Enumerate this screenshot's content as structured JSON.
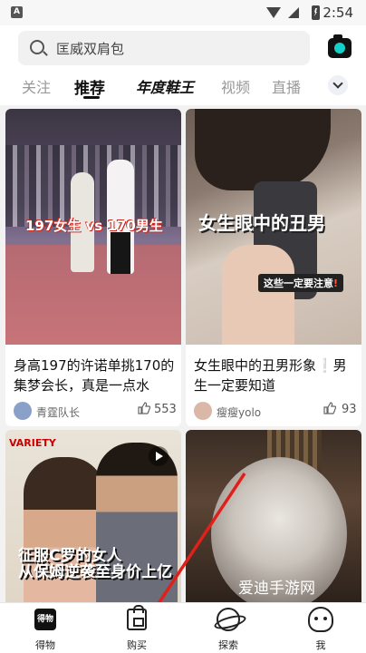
{
  "status_bar": {
    "app_badge": "A",
    "time": "2:54"
  },
  "search": {
    "placeholder": "匡威双肩包"
  },
  "tabs": [
    {
      "label": "关注"
    },
    {
      "label": "推荐",
      "active": true
    },
    {
      "label": "年度鞋王"
    },
    {
      "label": "视频"
    },
    {
      "label": "直播"
    }
  ],
  "feed": {
    "cards": [
      {
        "image_caption": "197女生 vs 170男生",
        "title": "身高197的许诺单挑170的集梦会长，真是一点水",
        "author": "青霆队长",
        "likes": "553"
      },
      {
        "image_caption": "女生眼中的丑男",
        "image_tag": "这些一定要注意",
        "image_tag_mark": "!",
        "title": "女生眼中的丑男形象❕男生一定要知道",
        "author": "瘦瘦yolo",
        "likes": "93"
      },
      {
        "image_logo": "VARIETY",
        "image_caption": "征服C罗的女人\n从保姆逆袭至身价上亿"
      },
      {
        "watermark": "爱迪手游网"
      }
    ]
  },
  "bottom_nav": [
    {
      "label": "得物",
      "icon": "dewu-logo-icon",
      "icon_text": "得物"
    },
    {
      "label": "购买",
      "icon": "shopping-bag-icon"
    },
    {
      "label": "探索",
      "icon": "planet-icon"
    },
    {
      "label": "我",
      "icon": "profile-face-icon"
    }
  ],
  "colors": {
    "accent": "#15d0c9",
    "annotation_arrow": "#e0201a"
  }
}
